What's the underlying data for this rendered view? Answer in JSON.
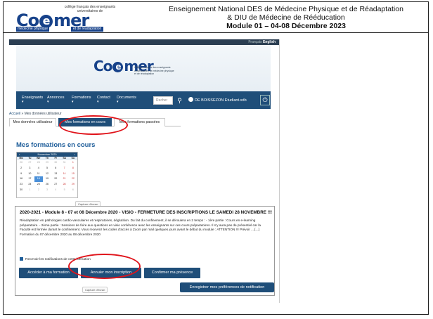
{
  "slide": {
    "logo": {
      "top_text": "collège français des enseignants universitaires de",
      "word_left": "Co",
      "word_e": "e",
      "word_right": "mer",
      "bottom_left": "médecine physique",
      "bottom_right": "et de réadaptation"
    },
    "title_line1": "Enseignement National DES de Médecine Physique et de Réadaptation",
    "title_line2": "& DIU de Médecine de Rééducation",
    "title_line3": "Module 01 – 04-08 Décembre 2023"
  },
  "site": {
    "langbar": {
      "fr": "Français",
      "en": "English"
    },
    "banner": {
      "word_left": "Co",
      "word_e": "e",
      "word_right": "mer",
      "tagline": "Collège français des enseignants universitaires de médecine physique et de réadaptation"
    },
    "nav": {
      "items": [
        "Enseignants",
        "Annonces",
        "Formations",
        "Contact",
        "Documents"
      ],
      "search_placeholder": "Recher",
      "user": "DE BOISSEZON Etudiant-xdb"
    },
    "breadcrumb": {
      "home": "Accueil",
      "sep": "»",
      "current": "Mes données utilisateur"
    },
    "tabs": [
      "Mes données utilisateur",
      "Mes formations en cours",
      "Mes formations passées"
    ],
    "section_title": "Mes formations en cours",
    "calendar": {
      "month": "Novembre 2020",
      "dow": [
        "Mo",
        "Tu",
        "We",
        "Th",
        "Fr",
        "Sa",
        "Su"
      ],
      "weeks": [
        [
          "26",
          "27",
          "28",
          "29",
          "30",
          "31",
          "1"
        ],
        [
          "2",
          "3",
          "4",
          "5",
          "6",
          "7",
          "8"
        ],
        [
          "9",
          "10",
          "11",
          "12",
          "13",
          "14",
          "15"
        ],
        [
          "16",
          "17",
          "18",
          "19",
          "20",
          "21",
          "22"
        ],
        [
          "23",
          "24",
          "25",
          "26",
          "27",
          "28",
          "29"
        ],
        [
          "30",
          "1",
          "2",
          "3",
          "4",
          "5",
          "6"
        ]
      ],
      "today": "18"
    },
    "capture_label": "Capture d'écran",
    "course": {
      "title": "2020-2021 - Module 8 - 07 et 08 Décembre 2020 - VISIO - FERMETURE DES INSCRIPTIONS LE SAMEDI 28 NOVEMBRE !!!",
      "desc_1": "Réadaptation en pathologies cardio-vasculaires et respiratoires, déglutition. Du fait du confinement, il se déroulera en 2 temps : - 1ère partie : Cours en e-learning préparatoire. - 2ème partie : Sessions de foire aux questions en visio conférence avec les enseignants sur ces cours préparatoires. Il n'y aura pas de présentiel car la Faculté est fermée durant le confinement. Vous recevrez les codes d'accès à Zoom par mail quelques jours avant le début du module : ATTENTION !!! Prévoir ... [...]",
      "desc_2": "Formation du 07 décembre 2020 au 08 décembre 2020",
      "notify": "Recevoir les notifications de cette formation",
      "btn_access": "Accéder à ma formation",
      "btn_cancel": "Annuler mon inscription",
      "btn_confirm": "Confirmer ma présence",
      "btn_prefs": "Enregistrer mes préférences de notification"
    }
  },
  "colors": {
    "accent": "#1f4e79",
    "highlight": "#e0141b",
    "title_blue": "#1f5e9a"
  }
}
